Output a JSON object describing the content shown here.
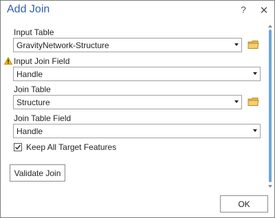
{
  "dialog": {
    "title": "Add Join",
    "help_label": "?",
    "close_label": "✕"
  },
  "fields": {
    "input_table": {
      "label": "Input Table",
      "value": "GravityNetwork-Structure"
    },
    "input_join_field": {
      "label": "Input Join Field",
      "value": "Handle"
    },
    "join_table": {
      "label": "Join Table",
      "value": "Structure"
    },
    "join_table_field": {
      "label": "Join Table Field",
      "value": "Handle"
    }
  },
  "keep_all": {
    "label": "Keep All Target Features",
    "checked": true
  },
  "buttons": {
    "validate_label": "Validate Join",
    "ok_label": "OK"
  },
  "colors": {
    "title": "#2b5fae",
    "folder": "#e8b84a",
    "warning": "#f2b500",
    "scroll_thumb": "#6aa6d8"
  },
  "icons": {
    "warning": "warning-icon",
    "folder": "folder-icon",
    "dropdown": "chevron-down-icon",
    "check": "check-icon"
  }
}
